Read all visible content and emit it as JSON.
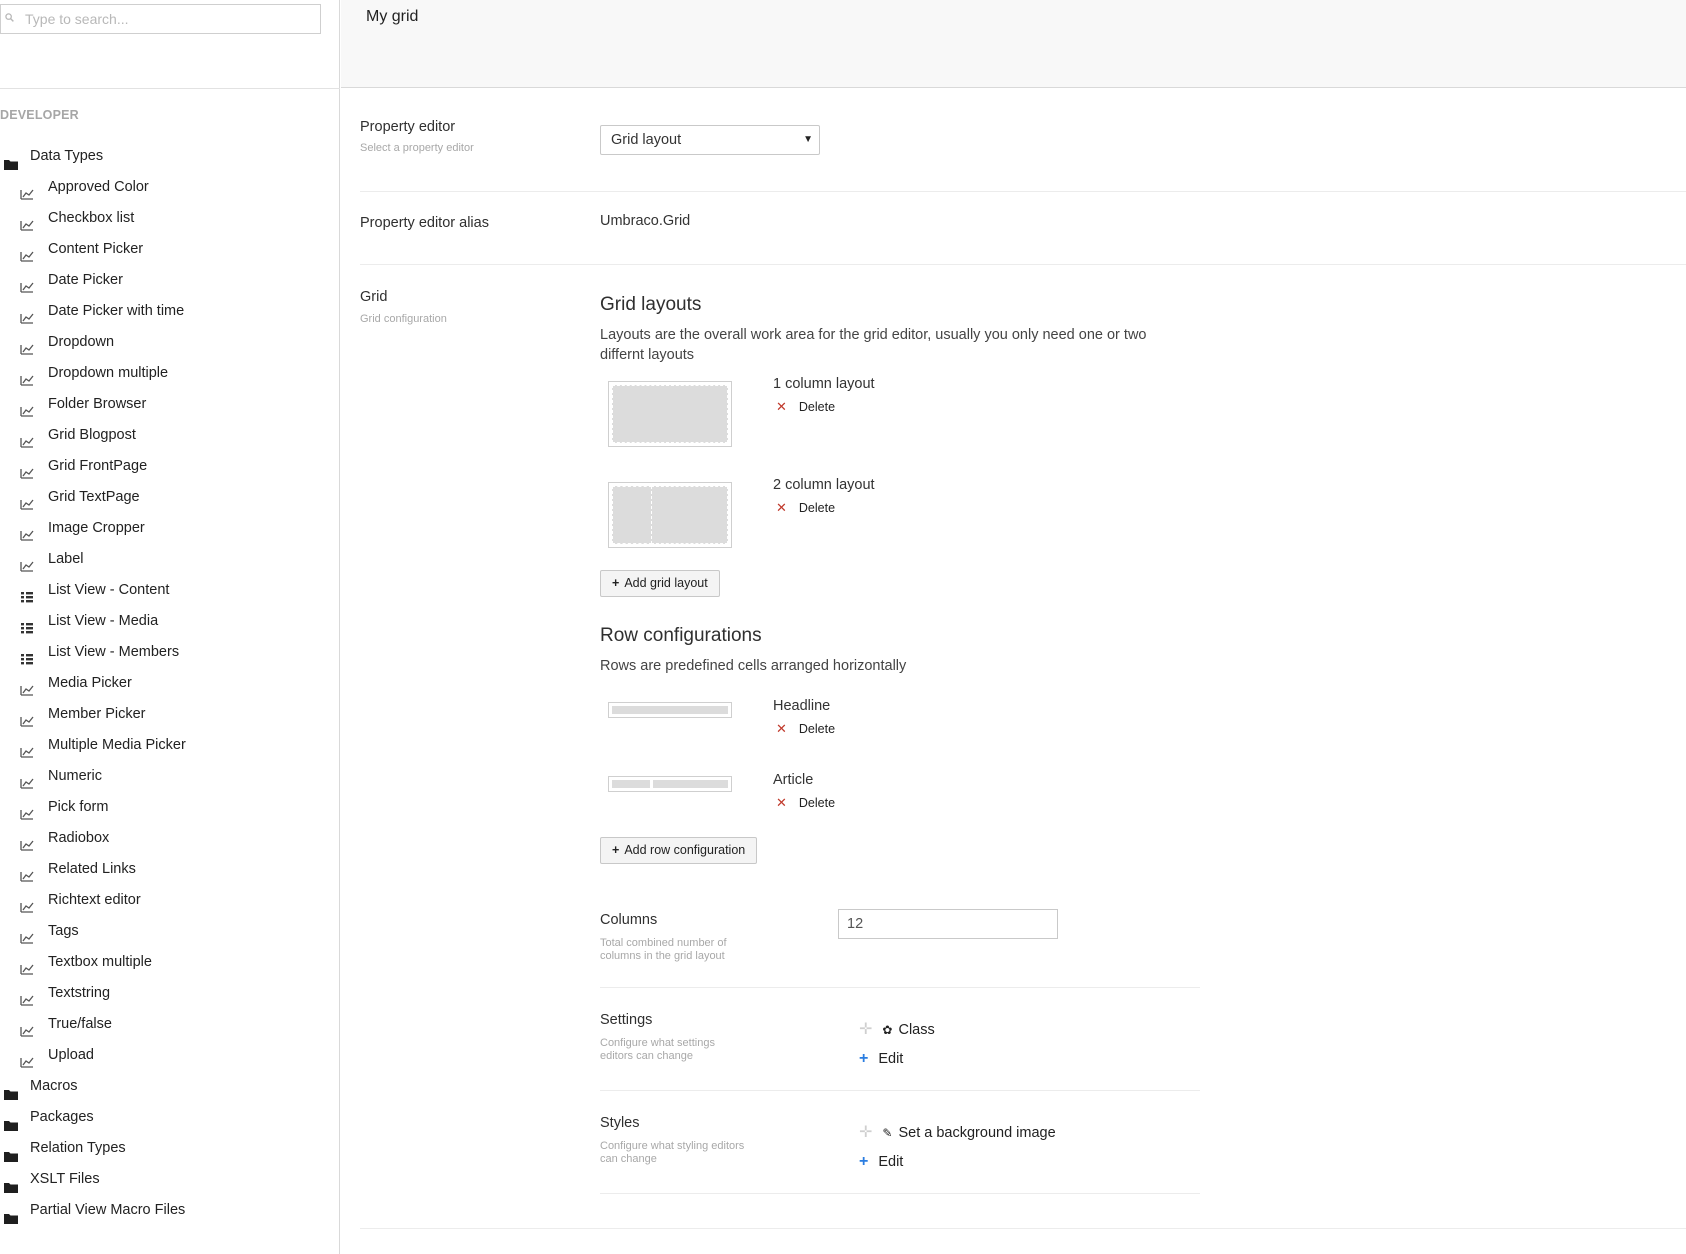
{
  "search": {
    "placeholder": "Type to search..."
  },
  "tree": {
    "section": "DEVELOPER",
    "items": [
      {
        "label": "Data Types",
        "level": "root",
        "icon": "folder-icon"
      },
      {
        "label": "Approved Color",
        "level": "child",
        "icon": "datatype-icon"
      },
      {
        "label": "Checkbox list",
        "level": "child",
        "icon": "datatype-icon"
      },
      {
        "label": "Content Picker",
        "level": "child",
        "icon": "datatype-icon"
      },
      {
        "label": "Date Picker",
        "level": "child",
        "icon": "datatype-icon"
      },
      {
        "label": "Date Picker with time",
        "level": "child",
        "icon": "datatype-icon"
      },
      {
        "label": "Dropdown",
        "level": "child",
        "icon": "datatype-icon"
      },
      {
        "label": "Dropdown multiple",
        "level": "child",
        "icon": "datatype-icon"
      },
      {
        "label": "Folder Browser",
        "level": "child",
        "icon": "datatype-icon"
      },
      {
        "label": "Grid Blogpost",
        "level": "child",
        "icon": "datatype-icon"
      },
      {
        "label": "Grid FrontPage",
        "level": "child",
        "icon": "datatype-icon"
      },
      {
        "label": "Grid TextPage",
        "level": "child",
        "icon": "datatype-icon"
      },
      {
        "label": "Image Cropper",
        "level": "child",
        "icon": "datatype-icon"
      },
      {
        "label": "Label",
        "level": "child",
        "icon": "datatype-icon"
      },
      {
        "label": "List View - Content",
        "level": "child",
        "icon": "listview-icon"
      },
      {
        "label": "List View - Media",
        "level": "child",
        "icon": "listview-icon"
      },
      {
        "label": "List View - Members",
        "level": "child",
        "icon": "listview-icon"
      },
      {
        "label": "Media Picker",
        "level": "child",
        "icon": "datatype-icon"
      },
      {
        "label": "Member Picker",
        "level": "child",
        "icon": "datatype-icon"
      },
      {
        "label": "Multiple Media Picker",
        "level": "child",
        "icon": "datatype-icon"
      },
      {
        "label": "Numeric",
        "level": "child",
        "icon": "datatype-icon"
      },
      {
        "label": "Pick form",
        "level": "child",
        "icon": "datatype-icon"
      },
      {
        "label": "Radiobox",
        "level": "child",
        "icon": "datatype-icon"
      },
      {
        "label": "Related Links",
        "level": "child",
        "icon": "datatype-icon"
      },
      {
        "label": "Richtext editor",
        "level": "child",
        "icon": "datatype-icon"
      },
      {
        "label": "Tags",
        "level": "child",
        "icon": "datatype-icon"
      },
      {
        "label": "Textbox multiple",
        "level": "child",
        "icon": "datatype-icon"
      },
      {
        "label": "Textstring",
        "level": "child",
        "icon": "datatype-icon"
      },
      {
        "label": "True/false",
        "level": "child",
        "icon": "datatype-icon"
      },
      {
        "label": "Upload",
        "level": "child",
        "icon": "datatype-icon"
      },
      {
        "label": "Macros",
        "level": "root",
        "icon": "folder-icon"
      },
      {
        "label": "Packages",
        "level": "root",
        "icon": "folder-icon"
      },
      {
        "label": "Relation Types",
        "level": "root",
        "icon": "folder-icon"
      },
      {
        "label": "XSLT Files",
        "level": "root",
        "icon": "folder-icon"
      },
      {
        "label": "Partial View Macro Files",
        "level": "root",
        "icon": "folder-icon"
      }
    ]
  },
  "header": {
    "title": "My grid"
  },
  "property_editor": {
    "label": "Property editor",
    "description": "Select a property editor",
    "selected": "Grid layout"
  },
  "alias": {
    "label": "Property editor alias",
    "value": "Umbraco.Grid"
  },
  "grid": {
    "label": "Grid",
    "description": "Grid configuration",
    "layouts": {
      "title": "Grid layouts",
      "description": "Layouts are the overall work area for the grid editor, usually you only need one or two differnt layouts",
      "items": [
        {
          "name": "1 column layout",
          "delete": "Delete"
        },
        {
          "name": "2 column layout",
          "delete": "Delete"
        }
      ],
      "add_label": "Add grid layout"
    },
    "rows": {
      "title": "Row configurations",
      "description": "Rows are predefined cells arranged horizontally",
      "items": [
        {
          "name": "Headline",
          "delete": "Delete"
        },
        {
          "name": "Article",
          "delete": "Delete"
        }
      ],
      "add_label": "Add row configuration"
    },
    "columns": {
      "label": "Columns",
      "description": "Total combined number of columns in the grid layout",
      "value": "12"
    },
    "settings": {
      "label": "Settings",
      "description": "Configure what settings editors can change",
      "item": "Class",
      "item_icon": "gear-icon",
      "edit": "Edit"
    },
    "styles": {
      "label": "Styles",
      "description": "Configure what styling editors can change",
      "item": "Set a background image",
      "item_icon": "pencil-icon",
      "edit": "Edit"
    }
  },
  "colors": {
    "delete_x": "#c0392b",
    "edit_plus": "#2a7de1",
    "header_bg": "#f8f8f8"
  }
}
